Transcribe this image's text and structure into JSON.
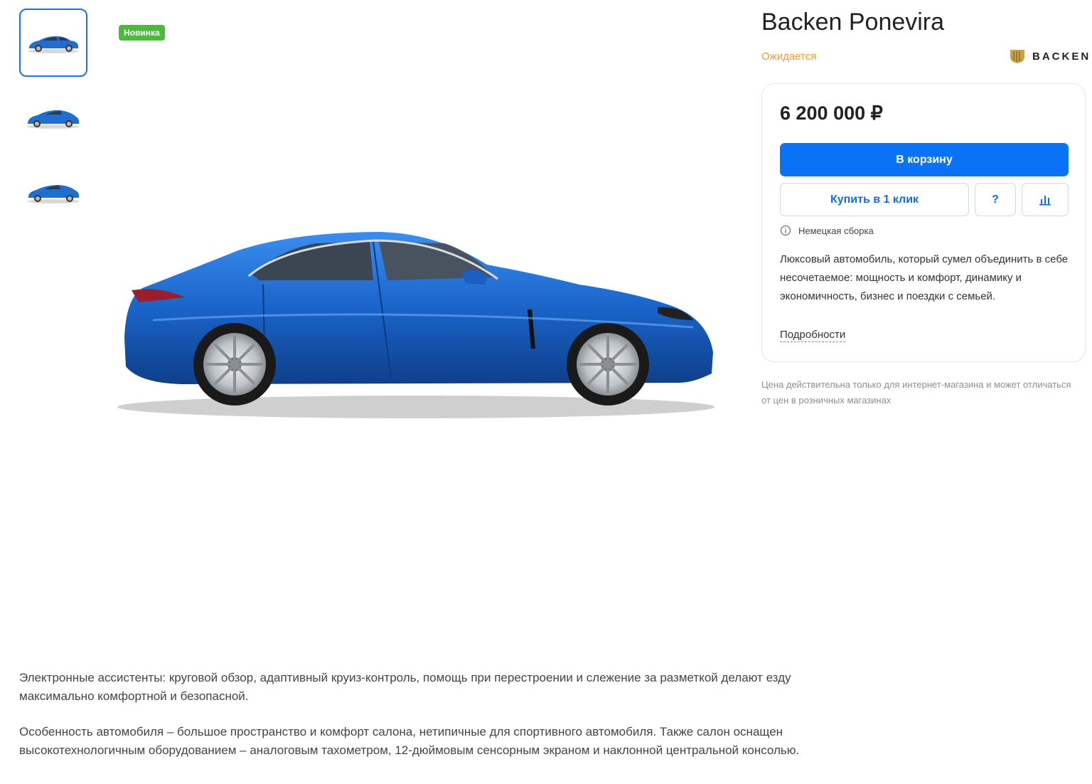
{
  "product": {
    "badge": "Новинка",
    "title": "Backen Ponevira",
    "status": "Ожидается",
    "brand": "BACKEN",
    "price": "6 200 000 ₽",
    "cart_label": "В корзину",
    "one_click_label": "Купить в 1 клик",
    "question_label": "?",
    "assembly": "Немецкая сборка",
    "description": "Люксовый автомобиль, который сумел объединить в себе несочетаемое: мощность и комфорт, динамику и экономичность, бизнес и поездки с семьей.",
    "more_label": "Подробности",
    "price_note": "Цена действительна только для интернет-магазина и может отличаться от цен в розничных магазинах"
  },
  "thumbnails": [
    {
      "icon": "car-photo-front-three-quarter",
      "active": true
    },
    {
      "icon": "car-photo-front-angle",
      "active": false
    },
    {
      "icon": "car-photo-rear-angle",
      "active": false
    }
  ],
  "colors": {
    "accent": "#0a73f5",
    "badge": "#4cbb3c",
    "status": "#f29a3c",
    "car_body": "#1f6fd1"
  },
  "details": {
    "paragraph_1": "Электронные ассистенты: круговой обзор, адаптивный круиз-контроль, помощь при перестроении и слежение за разметкой делают езду максимально комфортной и безопасной.",
    "paragraph_2": "Особенность автомобиля – большое пространство и комфорт салона, нетипичные для спортивного автомобиля. Также салон оснащен высокотехнологичным оборудованием – аналоговым тахометром, 12-дюймовым сенсорным экраном и наклонной центральной консолью."
  }
}
